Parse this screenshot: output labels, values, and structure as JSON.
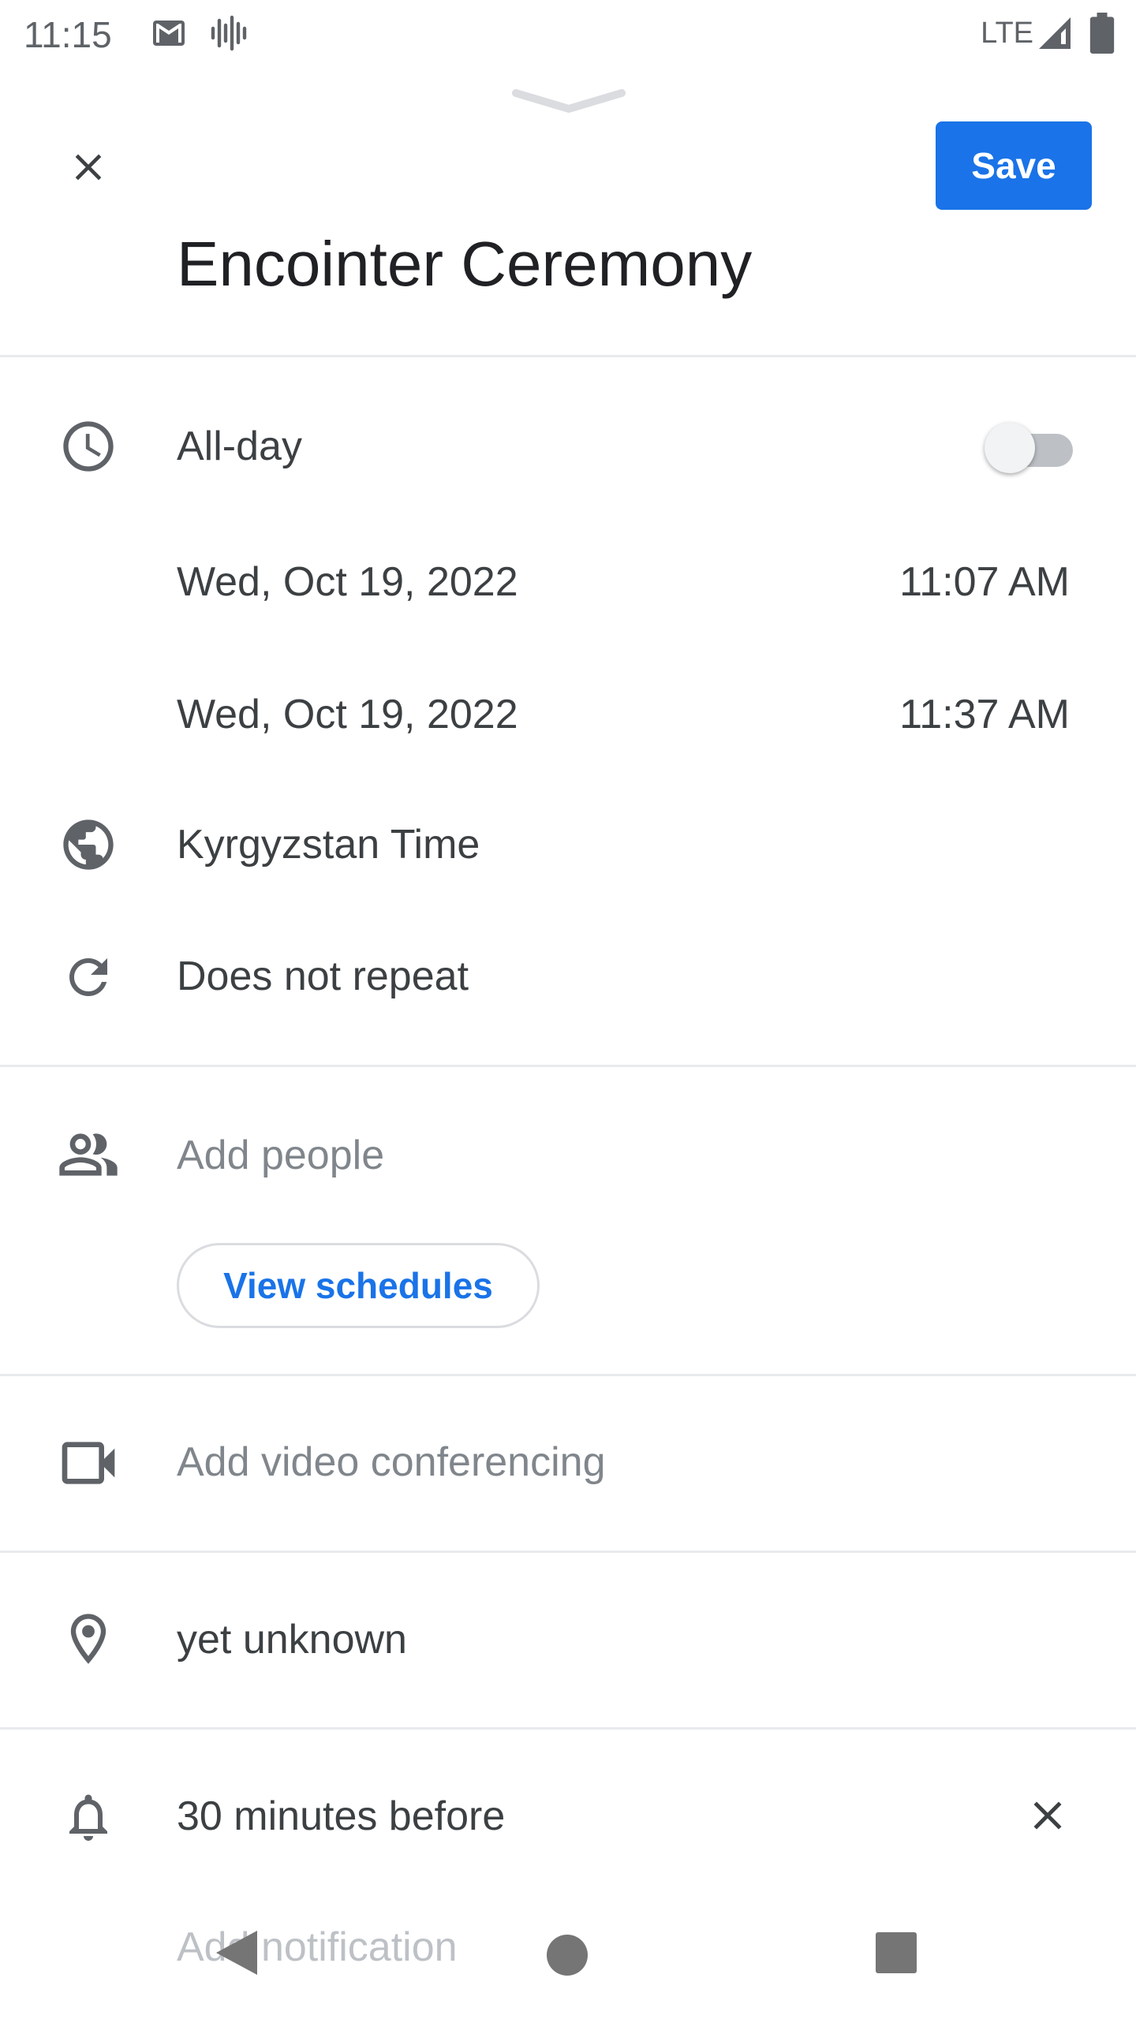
{
  "status_bar": {
    "time": "11:15",
    "network": "LTE",
    "icons": [
      "gmail-icon",
      "voice-icon",
      "signal-icon",
      "battery-icon"
    ]
  },
  "header": {
    "close_icon": "close-icon",
    "save_label": "Save",
    "title": "Encointer Ceremony"
  },
  "time_section": {
    "all_day_label": "All-day",
    "all_day_on": false,
    "start_date": "Wed, Oct 19, 2022",
    "start_time": "11:07 AM",
    "end_date": "Wed, Oct 19, 2022",
    "end_time": "11:37 AM",
    "timezone": "Kyrgyzstan Time",
    "repeat": "Does not repeat"
  },
  "people_section": {
    "placeholder": "Add people",
    "view_schedules_label": "View schedules"
  },
  "video_section": {
    "placeholder": "Add video conferencing"
  },
  "location_section": {
    "value": "yet unknown"
  },
  "notification_section": {
    "value": "30 minutes before",
    "add_label": "Add notification"
  },
  "colors": {
    "accent": "#1a73e8",
    "text": "#3c4043",
    "muted": "#80868b",
    "divider": "#e8eaed"
  }
}
